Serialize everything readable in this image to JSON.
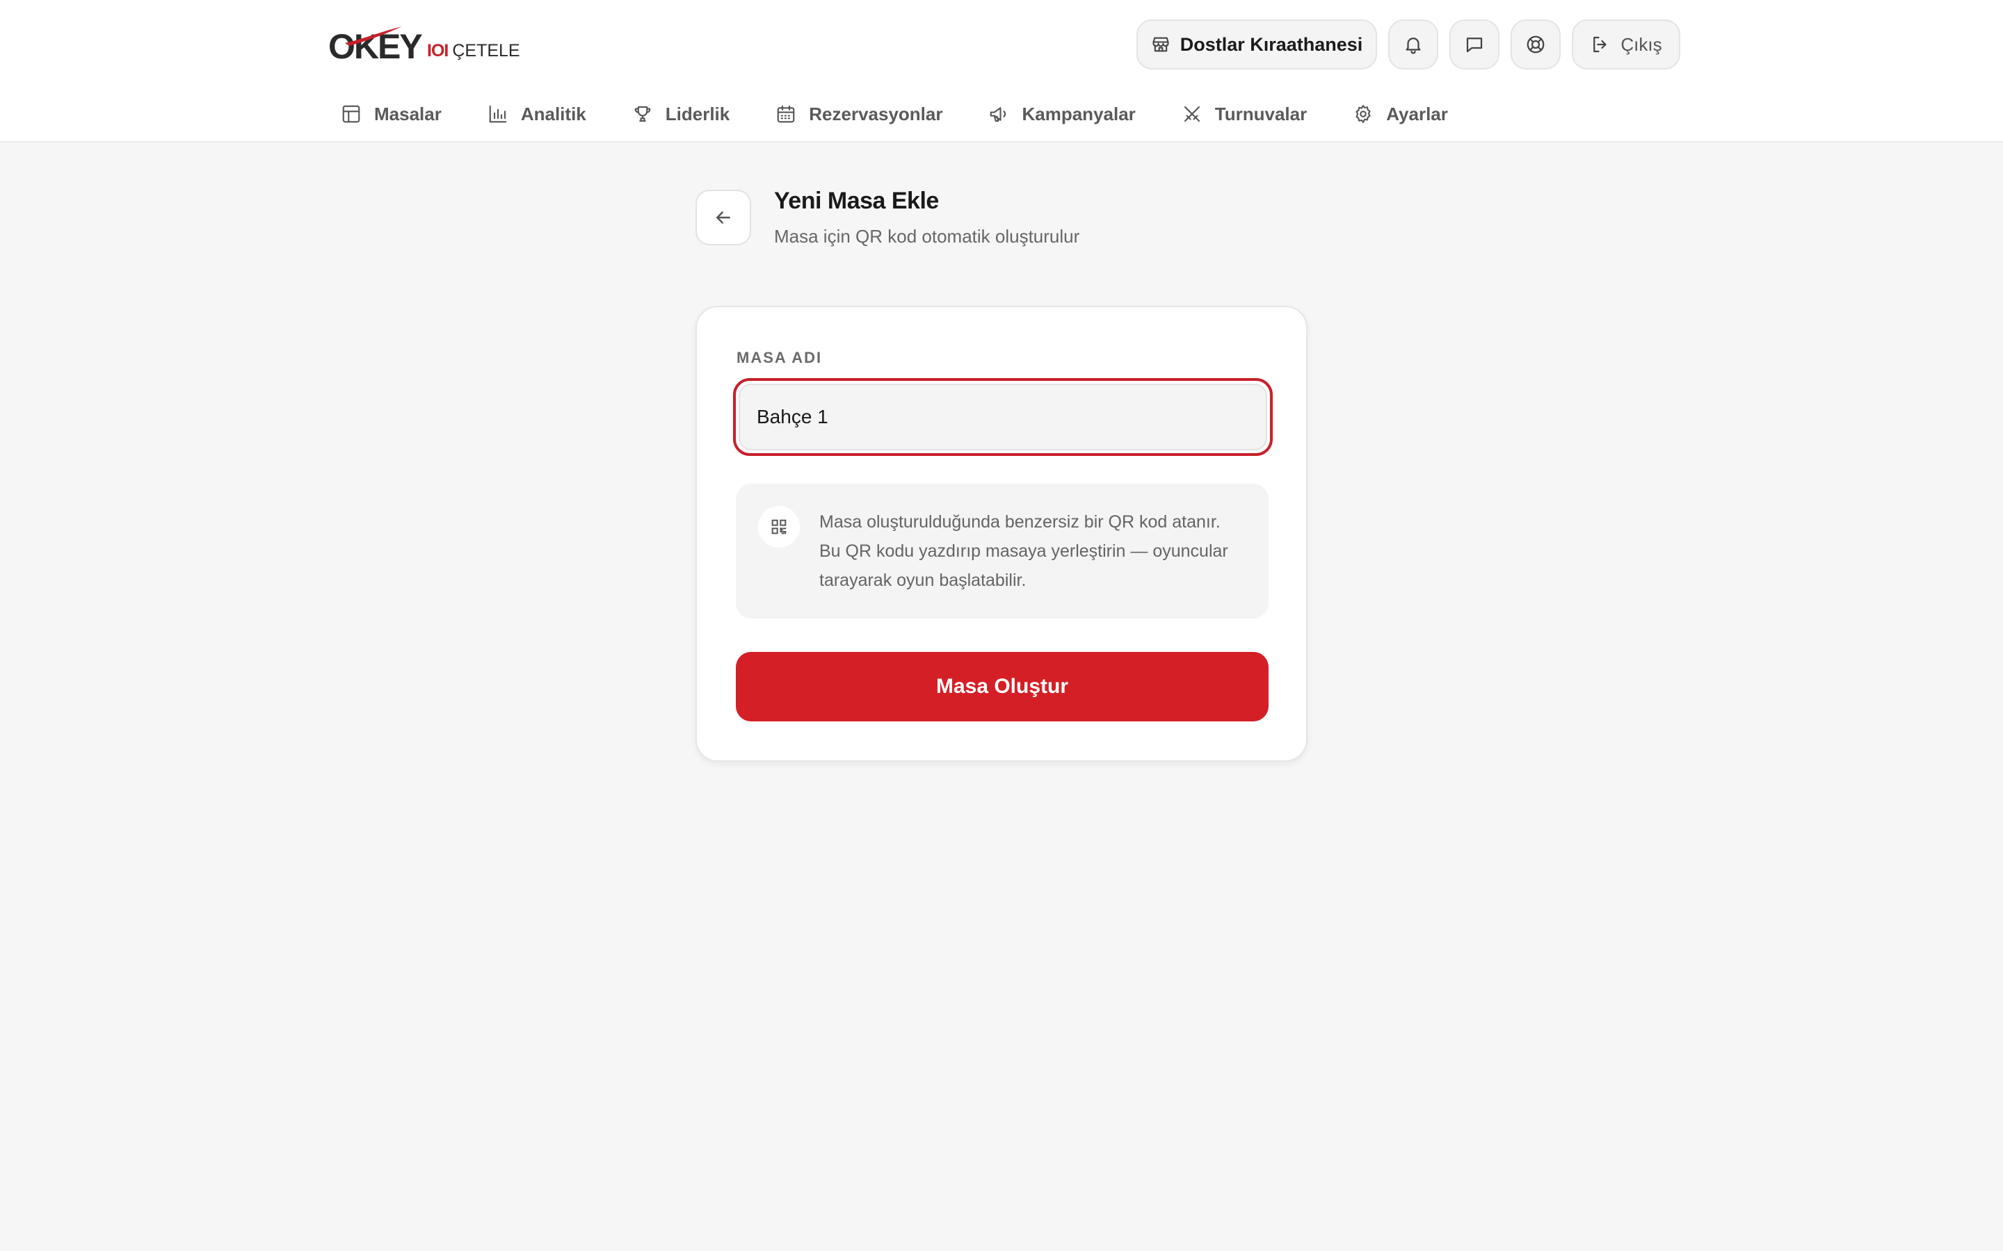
{
  "brand": {
    "logo_word": "OKEY",
    "logo_mark": "IOI",
    "logo_sub": "ÇETELE",
    "accent_color": "#d41f26"
  },
  "header": {
    "venue_name": "Dostlar Kıraathanesi",
    "venue_icon": "store-icon",
    "actions": [
      {
        "name": "notifications",
        "icon": "bell-icon"
      },
      {
        "name": "messages",
        "icon": "chat-icon"
      },
      {
        "name": "support",
        "icon": "lifebuoy-icon"
      }
    ],
    "logout_label": "Çıkış"
  },
  "nav": {
    "items": [
      {
        "label": "Masalar",
        "icon": "table-icon"
      },
      {
        "label": "Analitik",
        "icon": "bar-chart-icon"
      },
      {
        "label": "Liderlik",
        "icon": "trophy-icon"
      },
      {
        "label": "Rezervasyonlar",
        "icon": "calendar-icon"
      },
      {
        "label": "Kampanyalar",
        "icon": "megaphone-icon"
      },
      {
        "label": "Turnuvalar",
        "icon": "swords-icon"
      },
      {
        "label": "Ayarlar",
        "icon": "gear-icon"
      }
    ]
  },
  "page": {
    "title": "Yeni Masa Ekle",
    "subtitle": "Masa için QR kod otomatik oluşturulur"
  },
  "form": {
    "table_name_label": "MASA ADI",
    "table_name_value": "Bahçe 1",
    "info_text": "Masa oluşturulduğunda benzersiz bir QR kod atanır. Bu QR kodu yazdırıp masaya yerleştirin — oyuncular tarayarak oyun başlatabilir.",
    "submit_label": "Masa Oluştur"
  }
}
